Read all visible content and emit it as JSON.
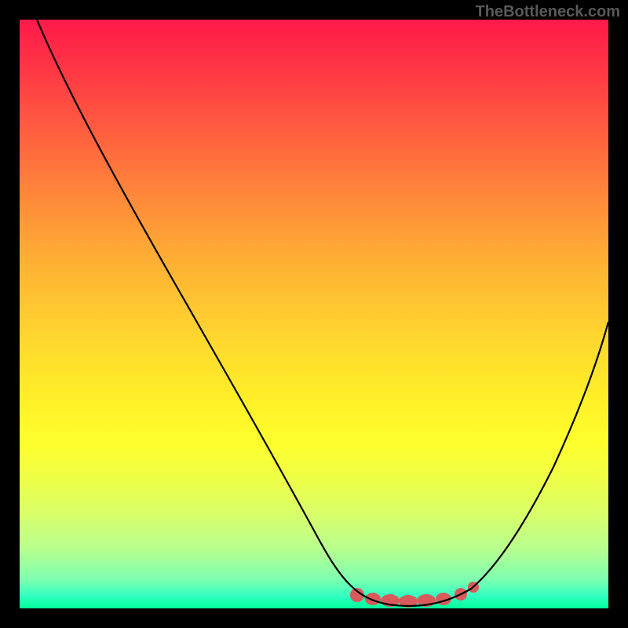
{
  "watermark": "TheBottleneck.com",
  "chart_data": {
    "type": "line",
    "title": "",
    "xlabel": "",
    "ylabel": "",
    "xlim": [
      0,
      100
    ],
    "ylim": [
      0,
      100
    ],
    "background": "vertical gradient red-to-green (bottleneck severity scale)",
    "series": [
      {
        "name": "bottleneck-curve",
        "x": [
          3,
          10,
          20,
          30,
          40,
          50,
          55,
          58,
          62,
          68,
          74,
          78,
          82,
          88,
          95,
          100
        ],
        "y": [
          100,
          87,
          70,
          52,
          35,
          18,
          9,
          4,
          1,
          1,
          1,
          4,
          10,
          22,
          38,
          50
        ]
      }
    ],
    "annotations": [
      {
        "name": "optimal-zone-marker",
        "x_range": [
          56,
          78
        ],
        "y": 2,
        "color": "#d85a5a"
      }
    ]
  }
}
